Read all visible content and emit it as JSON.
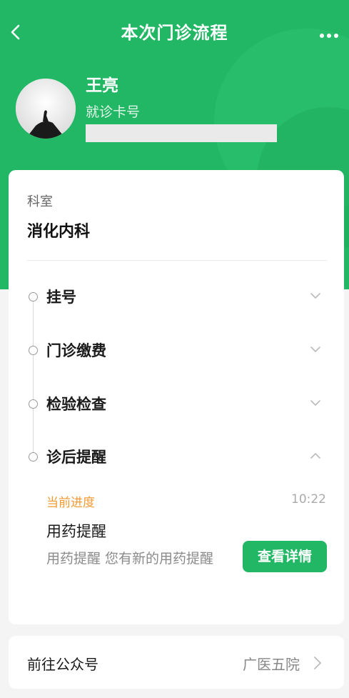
{
  "navbar": {
    "title": "本次门诊流程",
    "back_icon": "chevron-left-icon",
    "more_icon": "more-dots-icon"
  },
  "patient": {
    "name": "王亮",
    "card_label": "就诊卡号"
  },
  "department": {
    "label": "科室",
    "name": "消化内科"
  },
  "steps": [
    {
      "label": "挂号",
      "state": "collapsed"
    },
    {
      "label": "门诊缴费",
      "state": "collapsed"
    },
    {
      "label": "检验检查",
      "state": "collapsed"
    },
    {
      "label": "诊后提醒",
      "state": "expanded"
    }
  ],
  "progress": {
    "label": "当前进度",
    "time": "10:22",
    "title": "用药提醒",
    "description": "用药提醒 您有新的用药提醒",
    "button_label": "查看详情"
  },
  "footer": {
    "label": "前往公众号",
    "value": "广医五院"
  },
  "colors": {
    "brand_green": "#22b764",
    "progress_orange": "#f29a33"
  }
}
